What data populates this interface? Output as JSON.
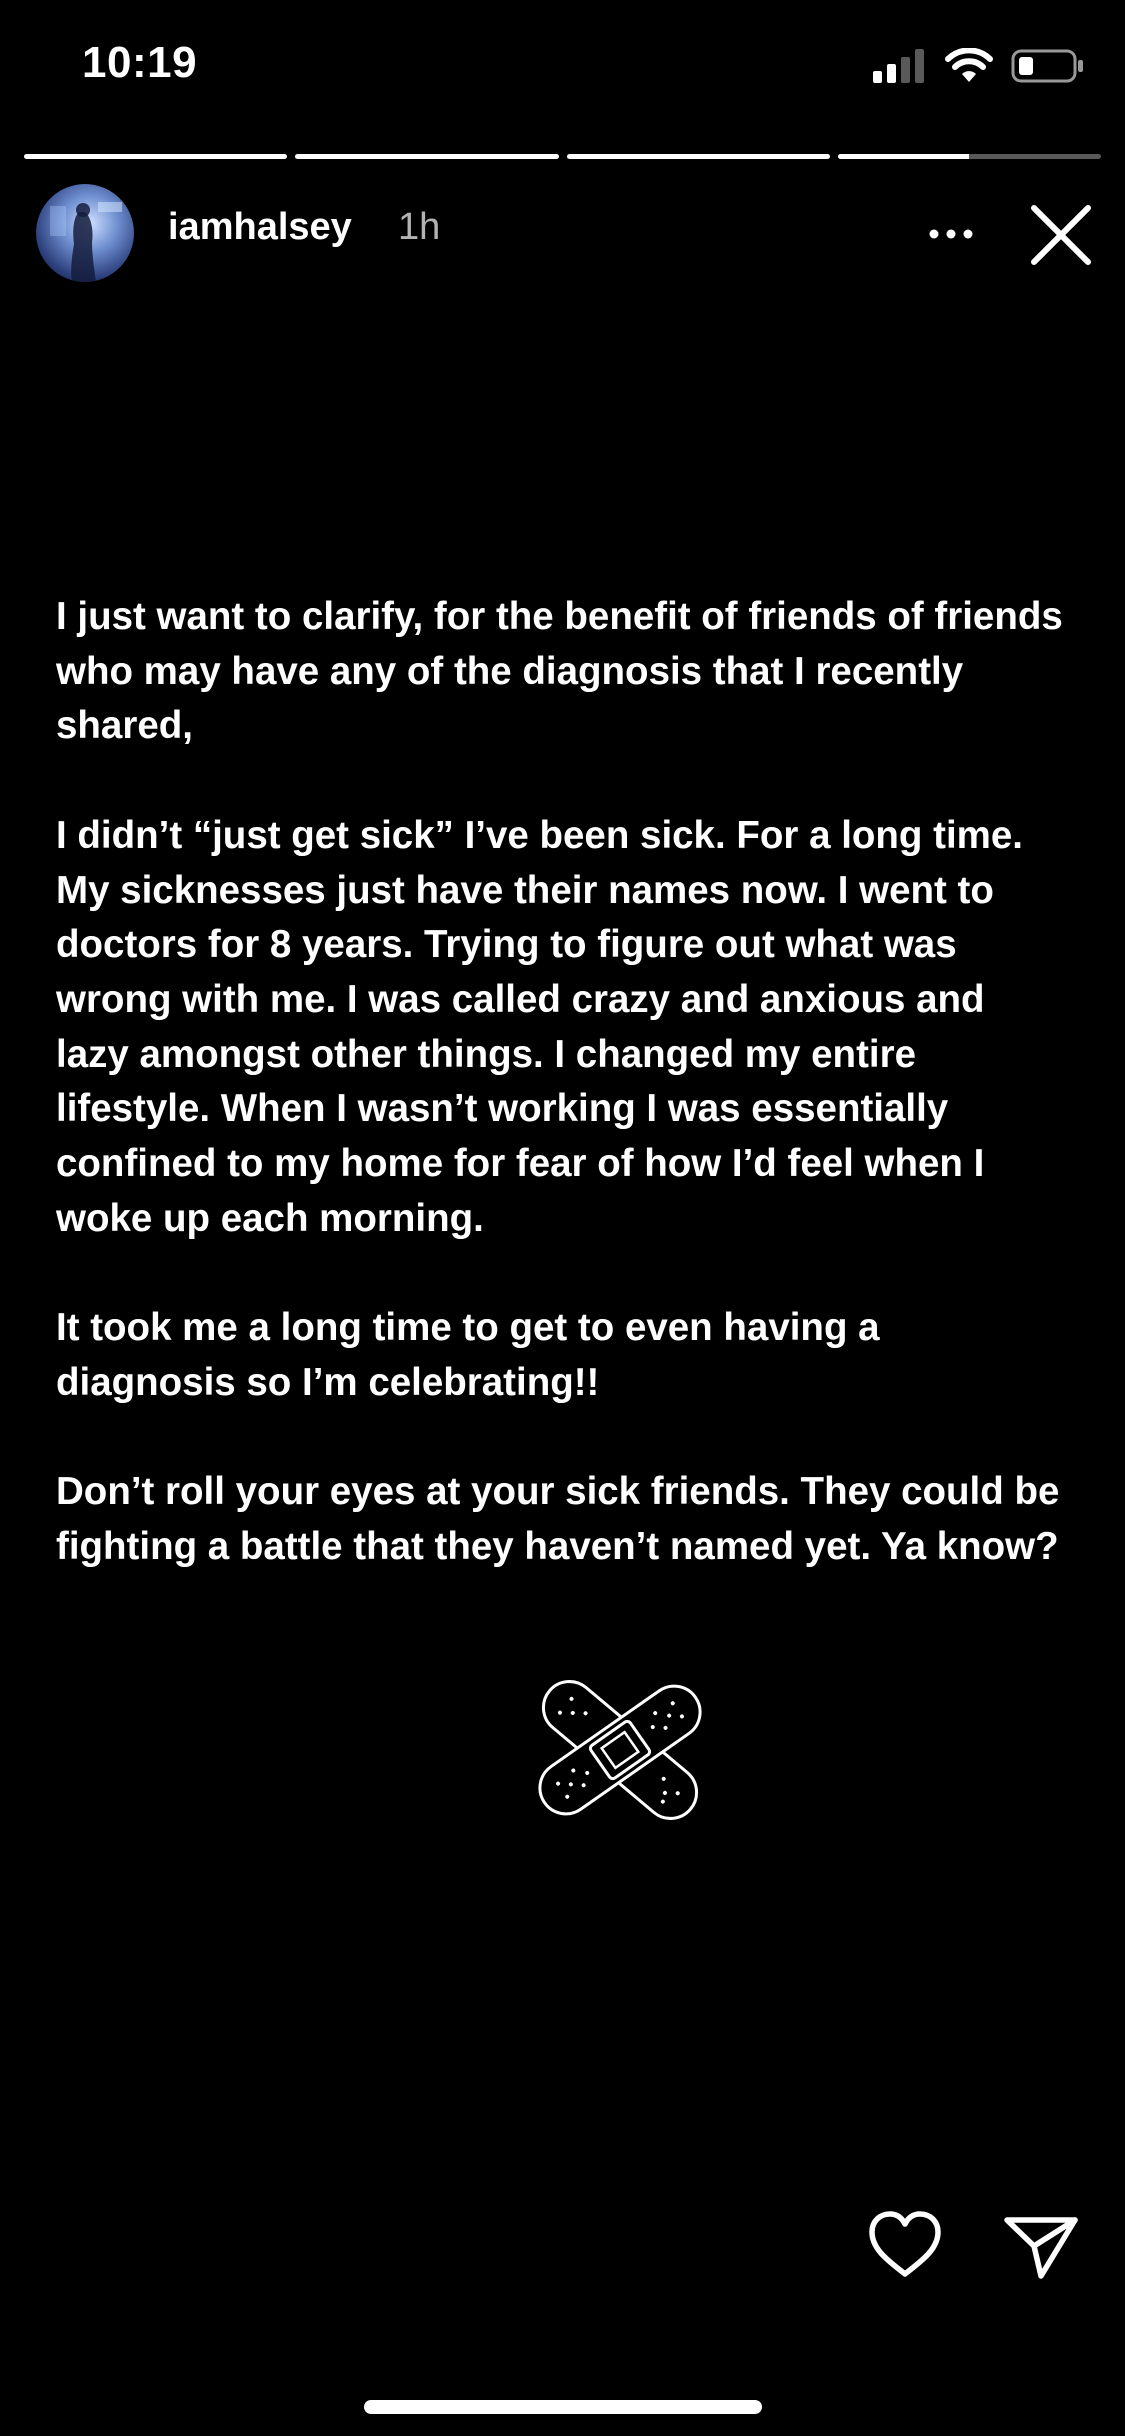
{
  "status_bar": {
    "time": "10:19",
    "icons": [
      "cellular-signal-icon",
      "wifi-icon",
      "battery-icon"
    ]
  },
  "progress": {
    "segments": [
      1,
      1,
      1,
      0.5
    ]
  },
  "header": {
    "username": "iamhalsey",
    "timestamp": "1h",
    "more_icon": "more-options-icon",
    "close_icon": "close-icon"
  },
  "story": {
    "paragraphs": [
      "I just want to clarify, for the benefit of friends of friends who may have any of the diagnosis that I recently shared,",
      "I didn’t “just get sick” I’ve been sick. For a long time. My sicknesses just have their names now. I went to doctors for 8 years. Trying to figure out what was wrong with me. I was called crazy and anxious and lazy amongst other things. I changed my entire lifestyle. When I wasn’t working I was essentially confined to my home for fear of how I’d feel when I woke up each morning.",
      "It took me a long time to get to even having a diagnosis so I’m celebrating!!",
      "Don’t roll your eyes at your sick friends. They could be fighting a battle that they haven’t named yet. Ya know?"
    ],
    "sticker": "bandage-sticker"
  },
  "footer": {
    "like_icon": "heart-icon",
    "share_icon": "send-icon"
  },
  "colors": {
    "background": "#000000",
    "text": "#ffffff"
  }
}
